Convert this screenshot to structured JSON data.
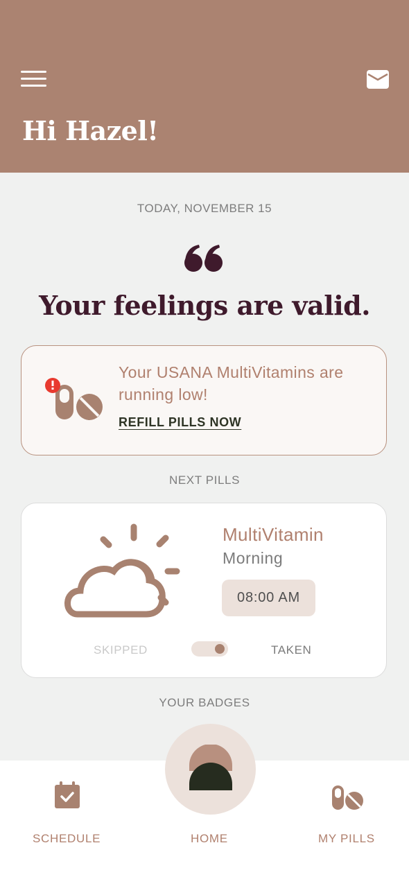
{
  "header": {
    "greeting": "Hi Hazel!",
    "menu_icon": "hamburger-menu-icon",
    "mail_icon": "envelope-icon",
    "background_color": "#ab8371"
  },
  "main": {
    "date": "TODAY, NOVEMBER 15",
    "quote_icon": "quote-mark-icon",
    "quote": "Your feelings are valid.",
    "alert": {
      "icon": "pills-warning-icon",
      "message": "Your USANA MultiVitamins are running low!",
      "link_label": "REFILL PILLS NOW"
    },
    "next_pills": {
      "section_label": "NEXT PILLS",
      "weather_icon": "partly-sunny-icon",
      "name": "MultiVitamin",
      "time_of_day": "Morning",
      "time": "08:00 AM",
      "skipped_label": "SKIPPED",
      "taken_label": "TAKEN",
      "taken": true
    },
    "badges_label": "YOUR BADGES"
  },
  "nav": {
    "schedule_label": "SCHEDULE",
    "home_label": "HOME",
    "pills_label": "MY PILLS",
    "accent_color": "#b0806e"
  }
}
